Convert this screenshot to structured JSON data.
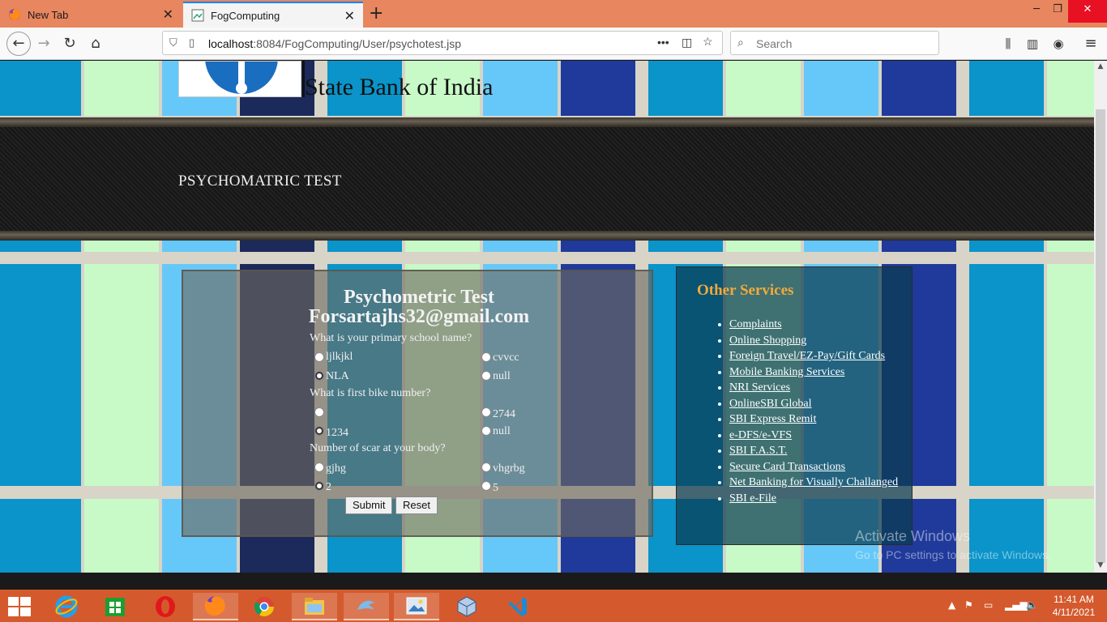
{
  "browser": {
    "tabs": [
      {
        "label": "New Tab",
        "active": false
      },
      {
        "label": "FogComputing",
        "active": true
      }
    ],
    "url_host": "localhost",
    "url_rest": ":8084/FogComputing/User/psychotest.jsp",
    "search_placeholder": "Search",
    "accent_color": "#0a84ff"
  },
  "page": {
    "bank_title": "State Bank of India",
    "banner_title": "PSYCHOMATRIC TEST",
    "form": {
      "heading_line1": "Psychometric Test",
      "heading_line2": "Forsartajhs32@gmail.com",
      "questions": [
        {
          "text": "What is your primary school name?",
          "options": [
            {
              "label": "ljlkjkl",
              "checked": false
            },
            {
              "label": "cvvcc",
              "checked": false
            },
            {
              "label": "NLA",
              "checked": true
            },
            {
              "label": "null",
              "checked": false
            }
          ]
        },
        {
          "text": "What is first bike number?",
          "options": [
            {
              "label": "",
              "checked": false
            },
            {
              "label": "2744",
              "checked": false
            },
            {
              "label": "1234",
              "checked": true
            },
            {
              "label": "null",
              "checked": false
            }
          ]
        },
        {
          "text": "Number of scar at your body?",
          "options": [
            {
              "label": "gjhg",
              "checked": false
            },
            {
              "label": "vhgrbg",
              "checked": false
            },
            {
              "label": "2",
              "checked": true
            },
            {
              "label": "5",
              "checked": false
            }
          ]
        }
      ],
      "submit_label": "Submit",
      "reset_label": "Reset"
    },
    "services": {
      "title": "Other Services",
      "title_color": "#f3a93b",
      "items": [
        "Complaints",
        "Online Shopping",
        "Foreign Travel/EZ-Pay/Gift Cards",
        "Mobile Banking Services",
        "NRI Services",
        "OnlineSBI Global",
        "SBI Express Remit",
        "e-DFS/e-VFS",
        "SBI F.A.S.T.",
        "Secure Card Transactions",
        "Net Banking for Visually Challanged",
        "SBI e-File"
      ]
    }
  },
  "watermark": {
    "line1": "Activate Windows",
    "line2": "Go to PC settings to activate Windows."
  },
  "taskbar": {
    "time": "11:41 AM",
    "date": "4/11/2021",
    "apps": [
      "internet-explorer",
      "store",
      "opera",
      "firefox",
      "chrome",
      "file-explorer",
      "dolphin-app",
      "photo-viewer",
      "virtualbox",
      "vscode"
    ],
    "active_app": "firefox"
  }
}
